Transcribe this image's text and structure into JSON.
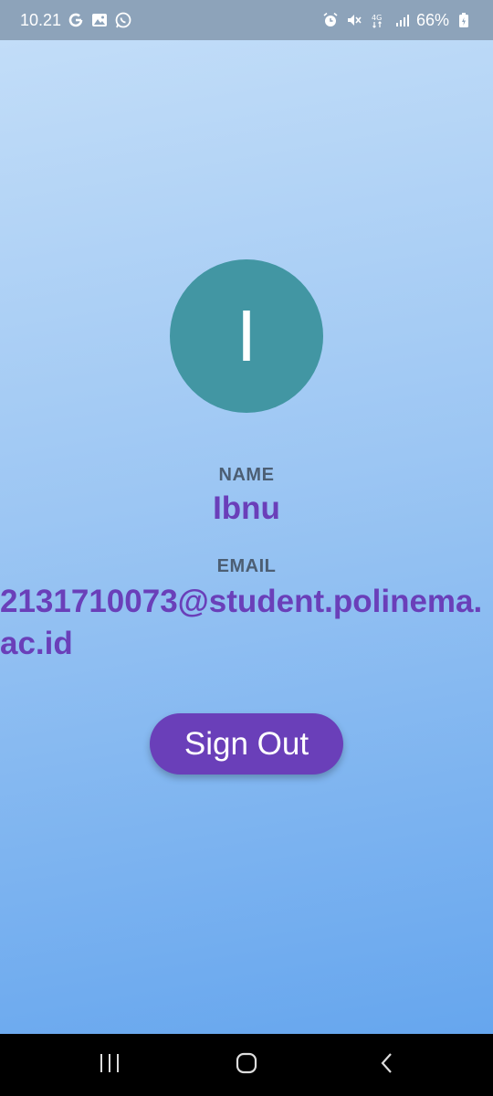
{
  "status_bar": {
    "time": "10.21",
    "battery": "66%",
    "left_icons": [
      "google-icon",
      "gallery-icon",
      "whatsapp-icon"
    ],
    "right_icons": [
      "alarm-icon",
      "mute-icon",
      "4g-icon",
      "signal-icon",
      "battery-icon"
    ]
  },
  "profile": {
    "avatar_initial": "I",
    "avatar_color": "#4296a3",
    "name_label": "NAME",
    "name_value": "Ibnu",
    "email_label": "EMAIL",
    "email_value": "2131710073@student.polinema.ac.id"
  },
  "actions": {
    "sign_out_label": "Sign Out"
  },
  "colors": {
    "accent": "#6a3fb9",
    "label": "#4c5e73"
  },
  "nav_bar": {
    "icons": [
      "recents-icon",
      "home-icon",
      "back-icon"
    ]
  }
}
